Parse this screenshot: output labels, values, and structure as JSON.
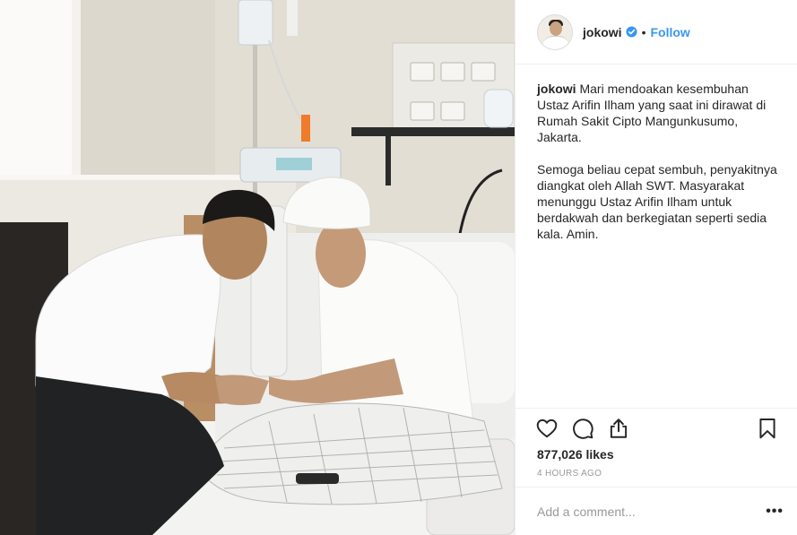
{
  "post": {
    "photo_alt": "Presiden Joko Widodo menjenguk Ustaz Arifin Ilham di rumah sakit",
    "header": {
      "avatar_icon": "profile-avatar",
      "username": "jokowi",
      "verified_icon": "verified-badge-icon",
      "separator": "•",
      "follow_label": "Follow",
      "follow_color": "#3897f0"
    },
    "caption": {
      "username": "jokowi",
      "paragraph_1": "Mari mendoakan kesembuhan Ustaz Arifin Ilham yang saat ini dirawat di Rumah Sakit Cipto Mangunkusumo, Jakarta.",
      "paragraph_2": "Semoga beliau cepat sembuh, penyakitnya diangkat oleh Allah SWT. Masyarakat menunggu Ustaz Arifin Ilham untuk berdakwah dan berkegiatan seperti sedia kala. Amin."
    },
    "actions": {
      "like_icon": "heart-icon",
      "comment_icon": "comment-icon",
      "share_icon": "share-icon",
      "save_icon": "bookmark-icon"
    },
    "likes": "877,026 likes",
    "timestamp": "4 HOURS AGO",
    "comment": {
      "placeholder": "Add a comment...",
      "value": "",
      "more_label": "•••"
    }
  }
}
